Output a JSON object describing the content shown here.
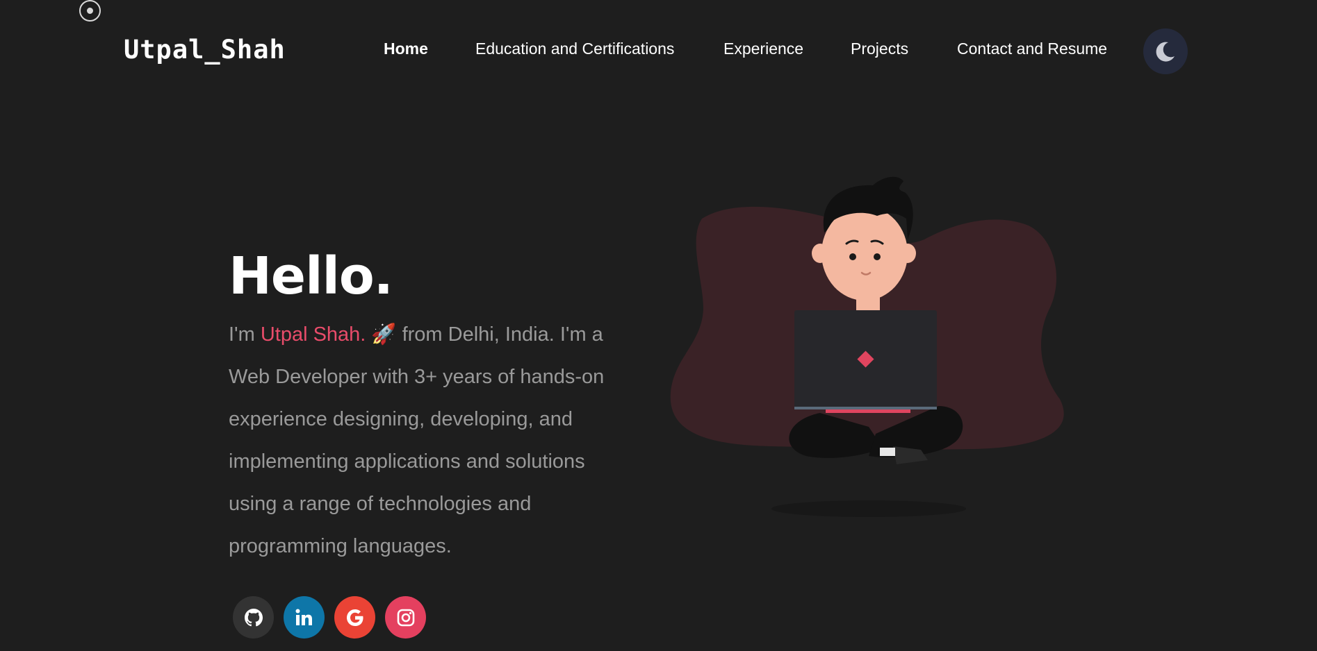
{
  "header": {
    "logo": "Utpal_Shah",
    "nav": [
      {
        "label": "Home",
        "active": true
      },
      {
        "label": "Education and Certifications",
        "active": false
      },
      {
        "label": "Experience",
        "active": false
      },
      {
        "label": "Projects",
        "active": false
      },
      {
        "label": "Contact and Resume",
        "active": false
      }
    ],
    "theme_toggle_icon": "moon-icon"
  },
  "hero": {
    "greeting": "Hello.",
    "intro_prefix": "I'm ",
    "name": "Utpal Shah.",
    "emoji": "🚀",
    "intro_rest": " from Delhi, India. I'm a Web Developer with 3+ years of hands-on experience designing, developing, and implementing applications and solutions using a range of technologies and programming languages.",
    "illustration": "developer-with-laptop-illustration"
  },
  "socials": [
    {
      "name": "github",
      "icon": "github-icon",
      "color": "#333333"
    },
    {
      "name": "linkedin",
      "icon": "linkedin-icon",
      "color": "#0e76a8"
    },
    {
      "name": "google",
      "icon": "google-icon",
      "color": "#ea4335"
    },
    {
      "name": "instagram",
      "icon": "instagram-icon",
      "color": "#e4405f"
    }
  ],
  "colors": {
    "background": "#1e1e1e",
    "accent": "#e84c6a",
    "text_muted": "#9a9a9a",
    "toggle_bg": "#252a3c"
  }
}
